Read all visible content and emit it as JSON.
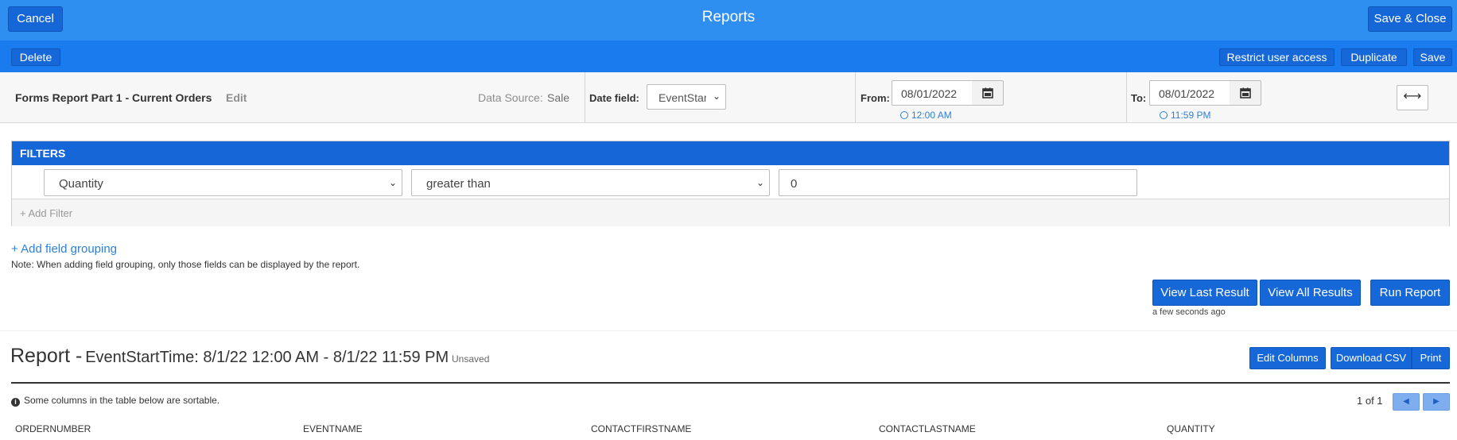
{
  "topbar": {
    "title": "Reports",
    "cancel_label": "Cancel",
    "save_close_label": "Save & Close",
    "color": "#2f8ff0"
  },
  "subbar": {
    "delete_label": "Delete",
    "restrict_label": "Restrict user access",
    "duplicate_label": "Duplicate",
    "save_label": "Save"
  },
  "controls": {
    "report_name": "Forms Report Part 1 - Current Orders",
    "edit_label": "Edit",
    "data_source_label": "Data Source:",
    "data_source_value": "Sale",
    "date_field_label": "Date field:",
    "date_field_value": "EventStartTime",
    "from_label": "From:",
    "from_date": "08/01/2022",
    "from_time": "12:00 AM",
    "to_label": "To:",
    "to_date": "08/01/2022",
    "to_time": "11:59 PM",
    "icons": [
      "calendar-icon",
      "clock-icon",
      "expand-arrows-icon"
    ]
  },
  "filters": {
    "header": "FILTERS",
    "field_value": "Quantity",
    "operator_value": "greater than",
    "value": "0",
    "add_filter_label": "+ Add Filter"
  },
  "grouping": {
    "add_label": "+ Add field grouping",
    "note": "Note: When adding field grouping, only those fields can be displayed by the report."
  },
  "actions": {
    "view_last_label": "View Last Result",
    "view_all_label": "View All Results",
    "run_label": "Run Report",
    "last_run": "a few seconds ago"
  },
  "report": {
    "title": "Report -",
    "range": "EventStartTime: 8/1/22 12:00 AM - 8/1/22 11:59 PM",
    "status": "Unsaved",
    "edit_columns_label": "Edit Columns",
    "download_csv_label": "Download CSV",
    "print_label": "Print",
    "sortable_note": "Some columns in the table below are sortable.",
    "pager": "1 of 1",
    "columns": [
      "ORDERNUMBER",
      "EVENTNAME",
      "CONTACTFIRSTNAME",
      "CONTACTLASTNAME",
      "QUANTITY"
    ]
  }
}
